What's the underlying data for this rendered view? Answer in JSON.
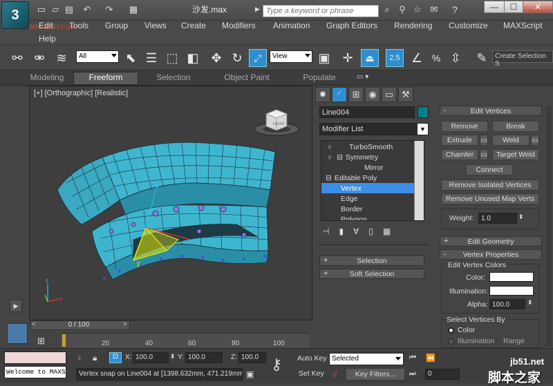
{
  "title_bar": {
    "doc_title": "沙发.max",
    "search_placeholder": "Type a keyword or phrase",
    "logo_text": "3",
    "window_buttons": [
      "—",
      "☐",
      "✕"
    ]
  },
  "menu": {
    "items": [
      "Edit",
      "Tools",
      "Group",
      "Views",
      "Create",
      "Modifiers",
      "Animation",
      "Graph Editors",
      "Rendering",
      "Customize",
      "MAXScript"
    ],
    "help": "Help",
    "watermark": "WWW.3DXY.COM"
  },
  "toolbar": {
    "selection_filter": "All",
    "ref_coord": "View",
    "snap_label": "2.5",
    "angle_label": "%",
    "named_selection": "Create Selection S"
  },
  "ribbon": {
    "tabs": [
      "Modeling",
      "Freeform",
      "Selection",
      "Object Paint",
      "Populate"
    ],
    "active": "Freeform"
  },
  "viewport": {
    "label": "[+] [Orthographic] [Realistic]",
    "viewcube_label": "FRONT",
    "axis_z": "z",
    "axis_y": "y",
    "axis_x": "x"
  },
  "command_panel": {
    "object_name": "Line004",
    "object_color": "#00808c",
    "modifier_list_label": "Modifier List",
    "stack": [
      {
        "label": "TurboSmooth",
        "indent": 1,
        "icon": "bulb",
        "selected": false
      },
      {
        "label": "Symmetry",
        "indent": 1,
        "icon": "bulb-plus",
        "selected": false
      },
      {
        "label": "Mirror",
        "indent": 3,
        "icon": "",
        "selected": false
      },
      {
        "label": "Editable Poly",
        "indent": 0,
        "icon": "plus",
        "selected": false
      },
      {
        "label": "Vertex",
        "indent": 2,
        "icon": "",
        "selected": true
      },
      {
        "label": "Edge",
        "indent": 2,
        "icon": "",
        "selected": false
      },
      {
        "label": "Border",
        "indent": 2,
        "icon": "",
        "selected": false
      },
      {
        "label": "Polygon",
        "indent": 2,
        "icon": "",
        "selected": false
      }
    ],
    "rollouts_left": [
      "Selection",
      "Soft Selection"
    ],
    "edit_vertices": {
      "title": "Edit Vertices",
      "remove": "Remove",
      "break": "Break",
      "extrude": "Extrude",
      "weld": "Weld",
      "chamfer": "Chamfer",
      "target_weld": "Target Weld",
      "connect": "Connect",
      "remove_isolated": "Remove Isolated Vertices",
      "remove_unused": "Remove Unused Map Verts",
      "weight_label": "Weight:",
      "weight_value": "1.0"
    },
    "edit_geometry_title": "Edit Geometry",
    "vertex_properties": {
      "title": "Vertex Properties",
      "edit_colors_group": "Edit Vertex Colors",
      "color_label": "Color:",
      "illumination_label": "Illumination:",
      "alpha_label": "Alpha:",
      "alpha_value": "100.0",
      "select_by_group": "Select Vertices By",
      "radio_color": "Color",
      "radio_illumination": "Illumination",
      "range_label": "Range"
    }
  },
  "timeline": {
    "frame_display": "0 / 100",
    "ticks": [
      "20",
      "40",
      "60",
      "80",
      "100"
    ]
  },
  "status": {
    "maxscript_text": "Welcome to MAXS",
    "prompt": "Vertex snap on Line004 at [1398.632mm, 471.219mm",
    "x_label": "X:",
    "x_value": "100.0",
    "y_label": "Y:",
    "y_value": "100.0",
    "z_label": "Z:",
    "z_value": "100.0",
    "auto_key": "Auto Key",
    "set_key": "Set Key",
    "key_mode": "Selected",
    "key_filters": "Key Filters...",
    "frame_field": "0"
  },
  "watermark_site": "jb51.net",
  "watermark_cn": "脚本之家",
  "colors": {
    "accent": "#2e8ecf",
    "selected_row": "#3d8ee6",
    "gizmo_yellow": "#e6e600"
  }
}
